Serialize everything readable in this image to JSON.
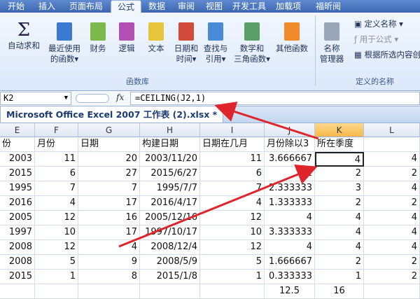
{
  "tabs": [
    "开始",
    "插入",
    "页面布局",
    "公式",
    "数据",
    "审阅",
    "视图",
    "开发工具",
    "加载项",
    "福昕阅"
  ],
  "active_tab": "公式",
  "ribbon": {
    "buttons": [
      {
        "label1": "自动求和",
        "label2": ""
      },
      {
        "label1": "最近使用",
        "label2": "的函数▾"
      },
      {
        "label1": "财务",
        "label2": ""
      },
      {
        "label1": "逻辑",
        "label2": ""
      },
      {
        "label1": "文本",
        "label2": ""
      },
      {
        "label1": "日期和",
        "label2": "时间▾"
      },
      {
        "label1": "查找与",
        "label2": "引用▾"
      },
      {
        "label1": "数学和",
        "label2": "三角函数▾"
      },
      {
        "label1": "其他函数",
        "label2": ""
      }
    ],
    "group_library": "函数库",
    "name_manager1": "名称",
    "name_manager2": "管理器",
    "define_name": "定义名称",
    "use_in_formula": "用于公式",
    "create_from_selection": "根据所选内容创",
    "group_names": "定义的名称"
  },
  "formula_bar": {
    "name_box": "K2",
    "fx": "fx",
    "formula": "=CEILING(J2,1)"
  },
  "workbook_title": "Microsoft Office Excel 2007 工作表 (2).xlsx *",
  "columns": [
    "E",
    "F",
    "G",
    "H",
    "I",
    "J",
    "K",
    "L"
  ],
  "header_row": [
    "份",
    "月份",
    "日期",
    "构建日期",
    "日期在几月",
    "月份除以3",
    "所在季度",
    ""
  ],
  "rows": [
    [
      "2003",
      "11",
      "20",
      "2003/11/20",
      "11",
      "3.666667",
      "4",
      "4"
    ],
    [
      "2015",
      "6",
      "27",
      "2015/6/27",
      "6",
      "2",
      "2",
      "2"
    ],
    [
      "1995",
      "7",
      "7",
      "1995/7/7",
      "7",
      "2.333333",
      "3",
      "4"
    ],
    [
      "2016",
      "4",
      "17",
      "2016/4/17",
      "4",
      "1.333333",
      "2",
      "2"
    ],
    [
      "2005",
      "12",
      "16",
      "2005/12/16",
      "12",
      "4",
      "4",
      "4"
    ],
    [
      "1997",
      "10",
      "17",
      "1997/10/17",
      "10",
      "3.333333",
      "4",
      "4"
    ],
    [
      "2008",
      "12",
      "4",
      "2008/12/4",
      "12",
      "4",
      "4",
      "4"
    ],
    [
      "2008",
      "5",
      "9",
      "2008/5/9",
      "5",
      "1.666667",
      "2",
      "2"
    ],
    [
      "2015",
      "1",
      "8",
      "2015/1/8",
      "1",
      "0.333333",
      "1",
      "2"
    ],
    [
      "",
      "",
      "",
      "",
      "",
      "12.5",
      "16",
      ""
    ]
  ],
  "arrow_color": "#e0242b"
}
